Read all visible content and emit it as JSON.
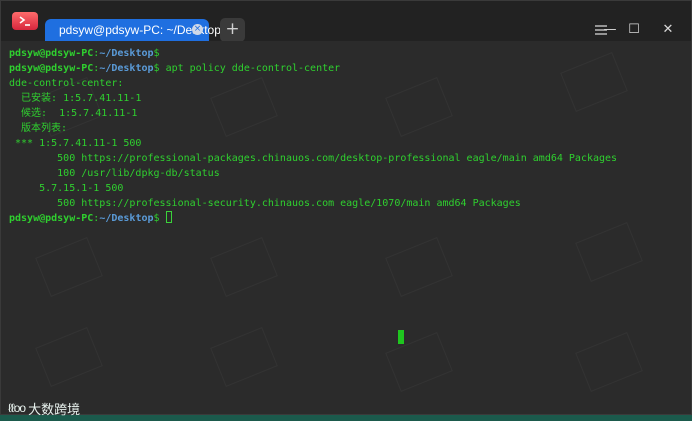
{
  "window": {
    "tab_title": "pdsyw@pdsyw-PC: ~/Desktop",
    "tab_close_glyph": "×",
    "new_tab_glyph": "+",
    "minimize_glyph": "—",
    "maximize_glyph": "☐",
    "close_glyph": "✕",
    "icons": [
      "terminal-icon",
      "plus-icon",
      "menu-icon",
      "minimize-icon",
      "maximize-icon",
      "close-icon"
    ]
  },
  "terminal": {
    "prompt_user": "pdsyw@pdsyw-PC",
    "prompt_sep": ":",
    "prompt_path": "~/Desktop",
    "prompt_symbol": "$",
    "command": " apt policy dde-control-center",
    "output": [
      "dde-control-center:",
      "  已安装: 1:5.7.41.11-1",
      "  候选:  1:5.7.41.11-1",
      "  版本列表:",
      " *** 1:5.7.41.11-1 500",
      "        500 https://professional-packages.chinauos.com/desktop-professional eagle/main amd64 Packages",
      "        100 /usr/lib/dpkg-db/status",
      "     5.7.15.1-1 500",
      "        500 https://professional-security.chinauos.com eagle/1070/main amd64 Packages"
    ]
  },
  "watermark": {
    "logo_mark": "ℓℓoo",
    "logo_text": "大数跨境"
  },
  "colors": {
    "prompt_green": "#2fd02f",
    "path_blue": "#5a9bd8",
    "tab_blue": "#1f6fe0",
    "background": "#2b2b2b"
  }
}
